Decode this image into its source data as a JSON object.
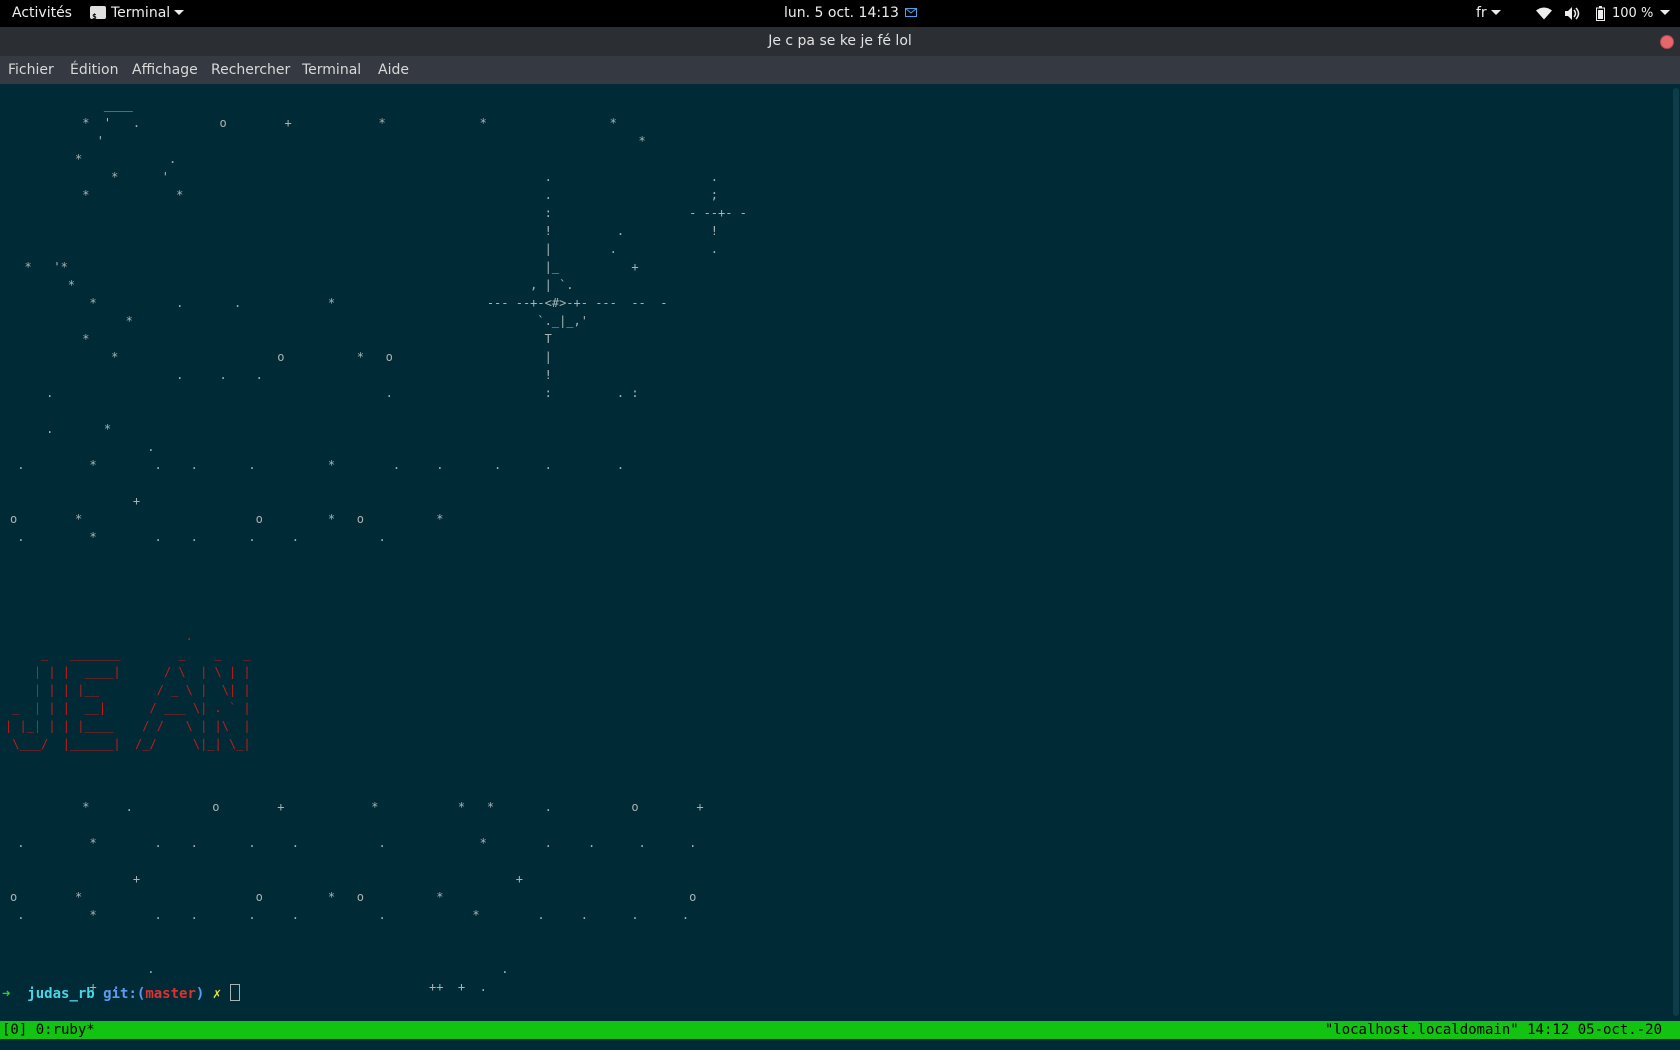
{
  "topbar": {
    "activities": "Activités",
    "app_name": "Terminal",
    "clock": "lun. 5 oct.  14:13",
    "language": "fr",
    "battery": "100 %"
  },
  "window": {
    "title": "Je c pa se ke je fé lol"
  },
  "menu": [
    "Fichier",
    "Édition",
    "Affichage",
    "Rechercher",
    "Terminal",
    "Aide"
  ],
  "terminal": {
    "stars_top": "             ____\n          *  '   .           o        +            *             *                 *\n            '                                                                          *\n         *            .\n              *      '                                                    .                      .\n          *            *                                                  .                      ;\n                                                                          :                   - --+- -\n                                                                          !         .            !\n                                                                          |        .             .\n  *   '*                                                                  |_          +\n        *                                                               , | `.\n           *           .       .            *                     --- --+-<#>-+- ---  --  -\n                *                                                        `._|_,'\n          *                                                               T\n              *                      o          *   o                     |\n                       .     .    .                                       !\n     .                                              .                     :         . :\n\n     .       *\n                   .\n .         *        .    .       .          *        .     .       .      .         .\n\n                 +\no        *                        o         *   o          *\n .         *        .    .       .     .           .",
    "banner": "                         .\n     _   _______        _    _   _\n    | | |  ____|      / \\  | \\ | |\n    | | | |__        / _ \\ |  \\| |\n _  | | |  __|      / ___ \\| . ` |\n| |_| | | |____    / /   \\ | |\\  |\n \\___/  |______|  /_/     \\|_| \\_|",
    "stars_bottom": "\n          *     .           o        +            *           *   *       .           o        +\n\n .         *        .    .       .     .           .             *        .     .      .      .\n\n                 +                                                    +\no        *                        o         *   o          *                                  o\n .         *        .    .       .     .           .            *        .     .      .      .\n\n\n                   .                                                .\n           +  .                                           ++  +  ."
  },
  "prompt": {
    "arrow": "➜",
    "directory": "judas_rb",
    "git_label": "git:(",
    "branch": "master",
    "git_close": ")",
    "dirty_mark": "✗"
  },
  "tmux": {
    "left": "[0] 0:ruby*",
    "right": "\"localhost.localdomain\" 14:12 05-oct.-20"
  },
  "colors": {
    "terminal_bg": "#002b36",
    "banner_red": "#c21a1a",
    "tmux_green": "#12c312"
  },
  "icons": [
    "terminal-app-icon",
    "mail-icon",
    "wifi-icon",
    "volume-icon",
    "battery-icon",
    "close-icon"
  ]
}
